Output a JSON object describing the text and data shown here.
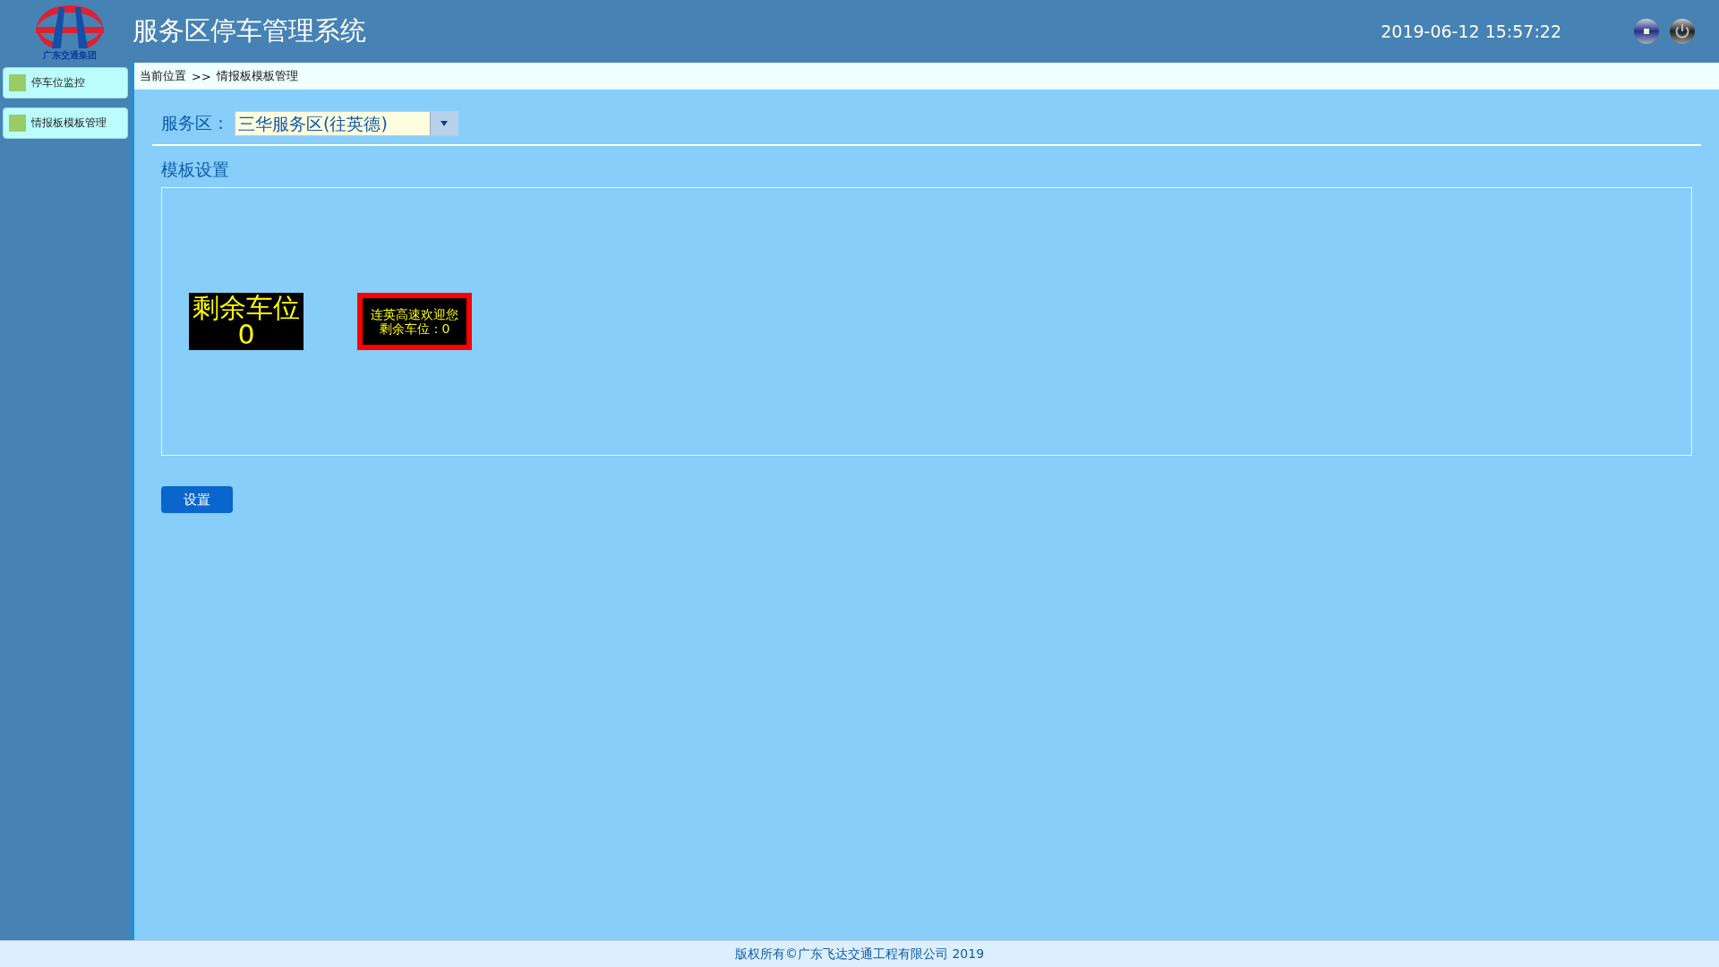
{
  "header": {
    "logo_text": "广东交通集团",
    "title": "服务区停车管理系统",
    "datetime": "2019-06-12 15:57:22"
  },
  "sidebar": {
    "items": [
      {
        "label": "停车位监控"
      },
      {
        "label": "情报板模板管理"
      }
    ]
  },
  "breadcrumb": {
    "label": "当前位置",
    "separator": ">>",
    "current": "情报板模板管理"
  },
  "form": {
    "label": "服务区：",
    "select_value": "三华服务区(往英德)"
  },
  "section": {
    "title": "模板设置",
    "templates": [
      {
        "kind": "large",
        "lines": [
          "剩余车位",
          "0"
        ],
        "selected": false
      },
      {
        "kind": "small",
        "lines": [
          "连英高速欢迎您",
          "剩余车位：0"
        ],
        "selected": true
      }
    ]
  },
  "button": "设置",
  "footer": "版权所有©广东飞达交通工程有限公司 2019"
}
